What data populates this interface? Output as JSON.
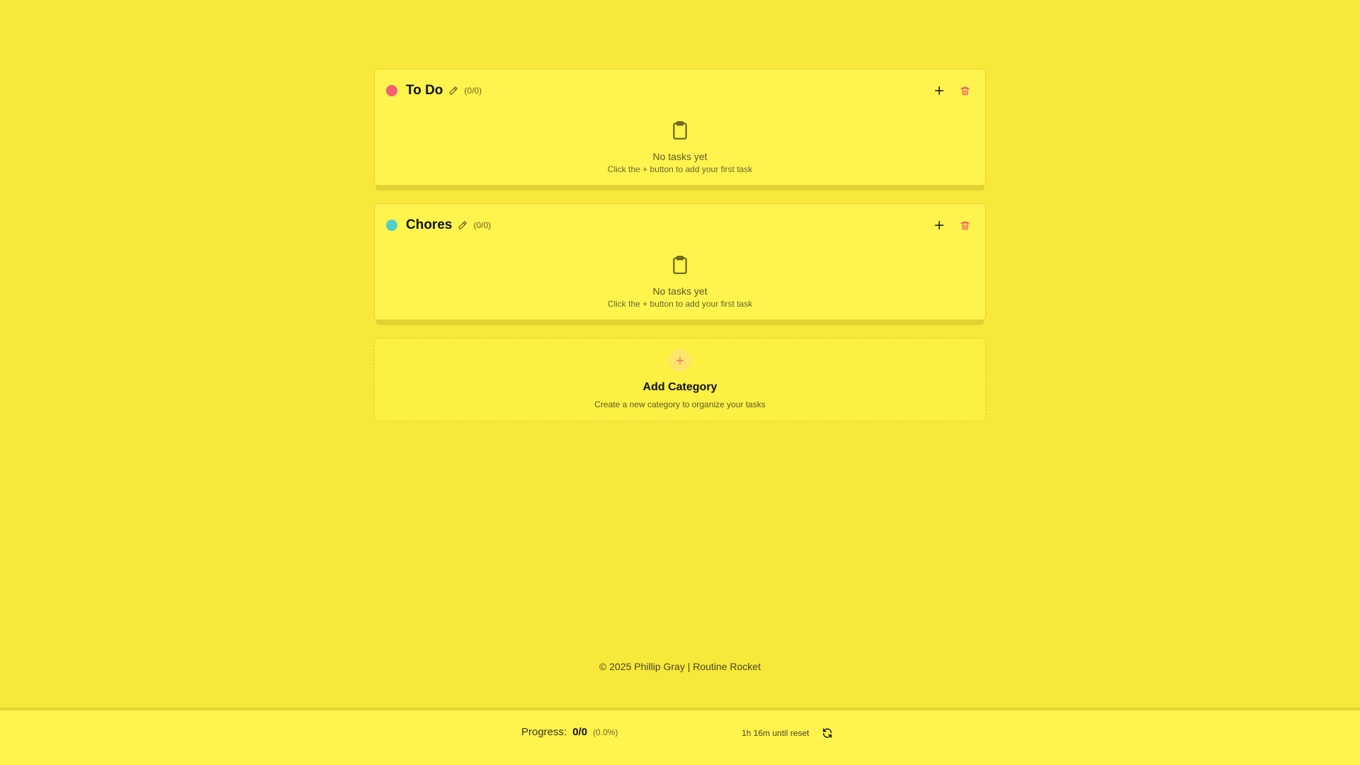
{
  "categories": [
    {
      "title": "To Do",
      "count": "(0/0)",
      "color": "#f75d73",
      "empty_title": "No tasks yet",
      "empty_subtitle": "Click the + button to add your first task"
    },
    {
      "title": "Chores",
      "count": "(0/0)",
      "color": "#4fd0c8",
      "empty_title": "No tasks yet",
      "empty_subtitle": "Click the + button to add your first task"
    }
  ],
  "add_category": {
    "title": "Add Category",
    "subtitle": "Create a new category to organize your tasks"
  },
  "footer": {
    "copyright": "© 2025 Phillip Gray | Routine Rocket"
  },
  "status_bar": {
    "progress_label": "Progress:",
    "progress_value": "0/0",
    "progress_percent": "(0.0%)",
    "reset_text": "1h 16m until reset"
  },
  "icons": {
    "edit": "pencil-icon",
    "add": "plus-icon",
    "delete": "trash-icon",
    "empty": "clipboard-icon",
    "refresh": "refresh-icon"
  }
}
